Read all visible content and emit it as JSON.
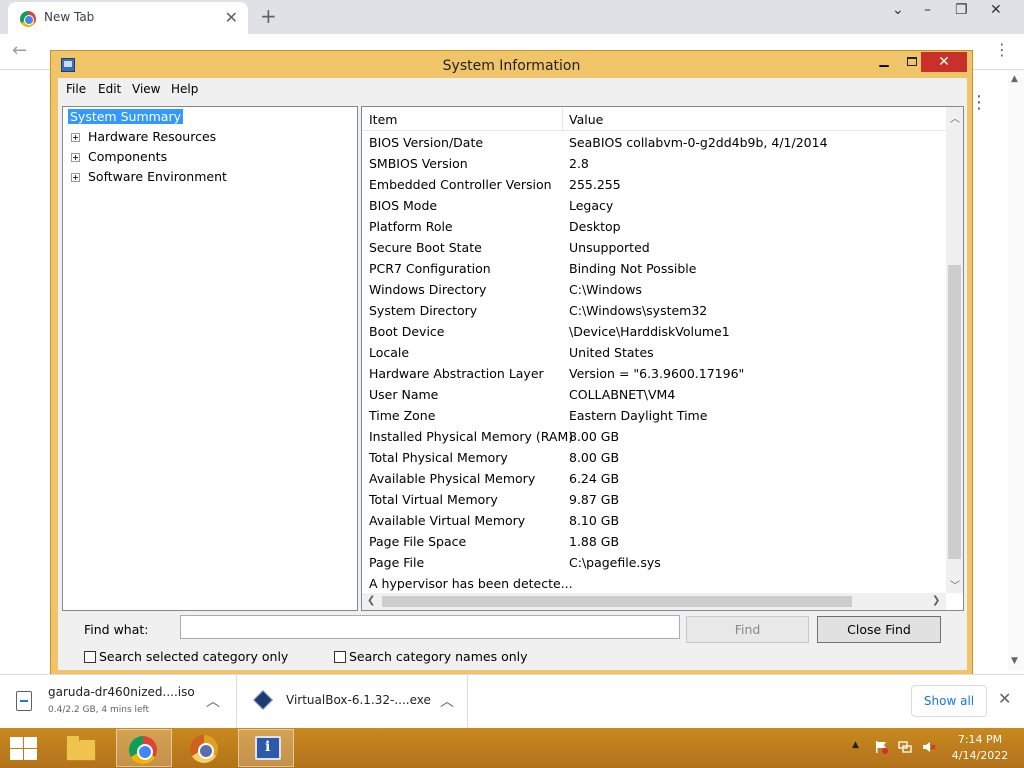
{
  "browser": {
    "tab_title": "New Tab",
    "download_bar": {
      "items": [
        {
          "name": "garuda-dr460nized....iso",
          "status": "0.4/2.2 GB, 4 mins left"
        },
        {
          "name": "VirtualBox-6.1.32-....exe"
        }
      ],
      "show_all_label": "Show all"
    }
  },
  "window": {
    "title": "System Information",
    "menu": [
      "File",
      "Edit",
      "View",
      "Help"
    ],
    "tree": [
      {
        "label": "System Summary",
        "selected": true
      },
      {
        "label": "Hardware Resources"
      },
      {
        "label": "Components"
      },
      {
        "label": "Software Environment"
      }
    ],
    "columns": {
      "item": "Item",
      "value": "Value"
    },
    "rows": [
      {
        "item": "BIOS Version/Date",
        "value": "SeaBIOS collabvm-0-g2dd4b9b, 4/1/2014"
      },
      {
        "item": "SMBIOS Version",
        "value": "2.8"
      },
      {
        "item": "Embedded Controller Version",
        "value": "255.255"
      },
      {
        "item": "BIOS Mode",
        "value": "Legacy"
      },
      {
        "item": "Platform Role",
        "value": "Desktop"
      },
      {
        "item": "Secure Boot State",
        "value": "Unsupported"
      },
      {
        "item": "PCR7 Configuration",
        "value": "Binding Not Possible"
      },
      {
        "item": "Windows Directory",
        "value": "C:\\Windows"
      },
      {
        "item": "System Directory",
        "value": "C:\\Windows\\system32"
      },
      {
        "item": "Boot Device",
        "value": "\\Device\\HarddiskVolume1"
      },
      {
        "item": "Locale",
        "value": "United States"
      },
      {
        "item": "Hardware Abstraction Layer",
        "value": "Version = \"6.3.9600.17196\""
      },
      {
        "item": "User Name",
        "value": "COLLABNET\\VM4"
      },
      {
        "item": "Time Zone",
        "value": "Eastern Daylight Time"
      },
      {
        "item": "Installed Physical Memory (RAM)",
        "value": "8.00 GB"
      },
      {
        "item": "Total Physical Memory",
        "value": "8.00 GB"
      },
      {
        "item": "Available Physical Memory",
        "value": "6.24 GB"
      },
      {
        "item": "Total Virtual Memory",
        "value": "9.87 GB"
      },
      {
        "item": "Available Virtual Memory",
        "value": "8.10 GB"
      },
      {
        "item": "Page File Space",
        "value": "1.88 GB"
      },
      {
        "item": "Page File",
        "value": "C:\\pagefile.sys"
      },
      {
        "item": "A hypervisor has been detecte...",
        "value": ""
      }
    ],
    "find": {
      "label": "Find what:",
      "value": "",
      "find_button": "Find",
      "close_find_button": "Close Find",
      "checkbox_selected_category": "Search selected category only",
      "checkbox_category_names": "Search category names only"
    }
  },
  "taskbar": {
    "time": "7:14 PM",
    "date": "4/14/2022"
  },
  "colors": {
    "window_frame": "#f0c468",
    "selection": "#3399ff",
    "close_button": "#c7312a",
    "taskbar": "#c9891f"
  }
}
